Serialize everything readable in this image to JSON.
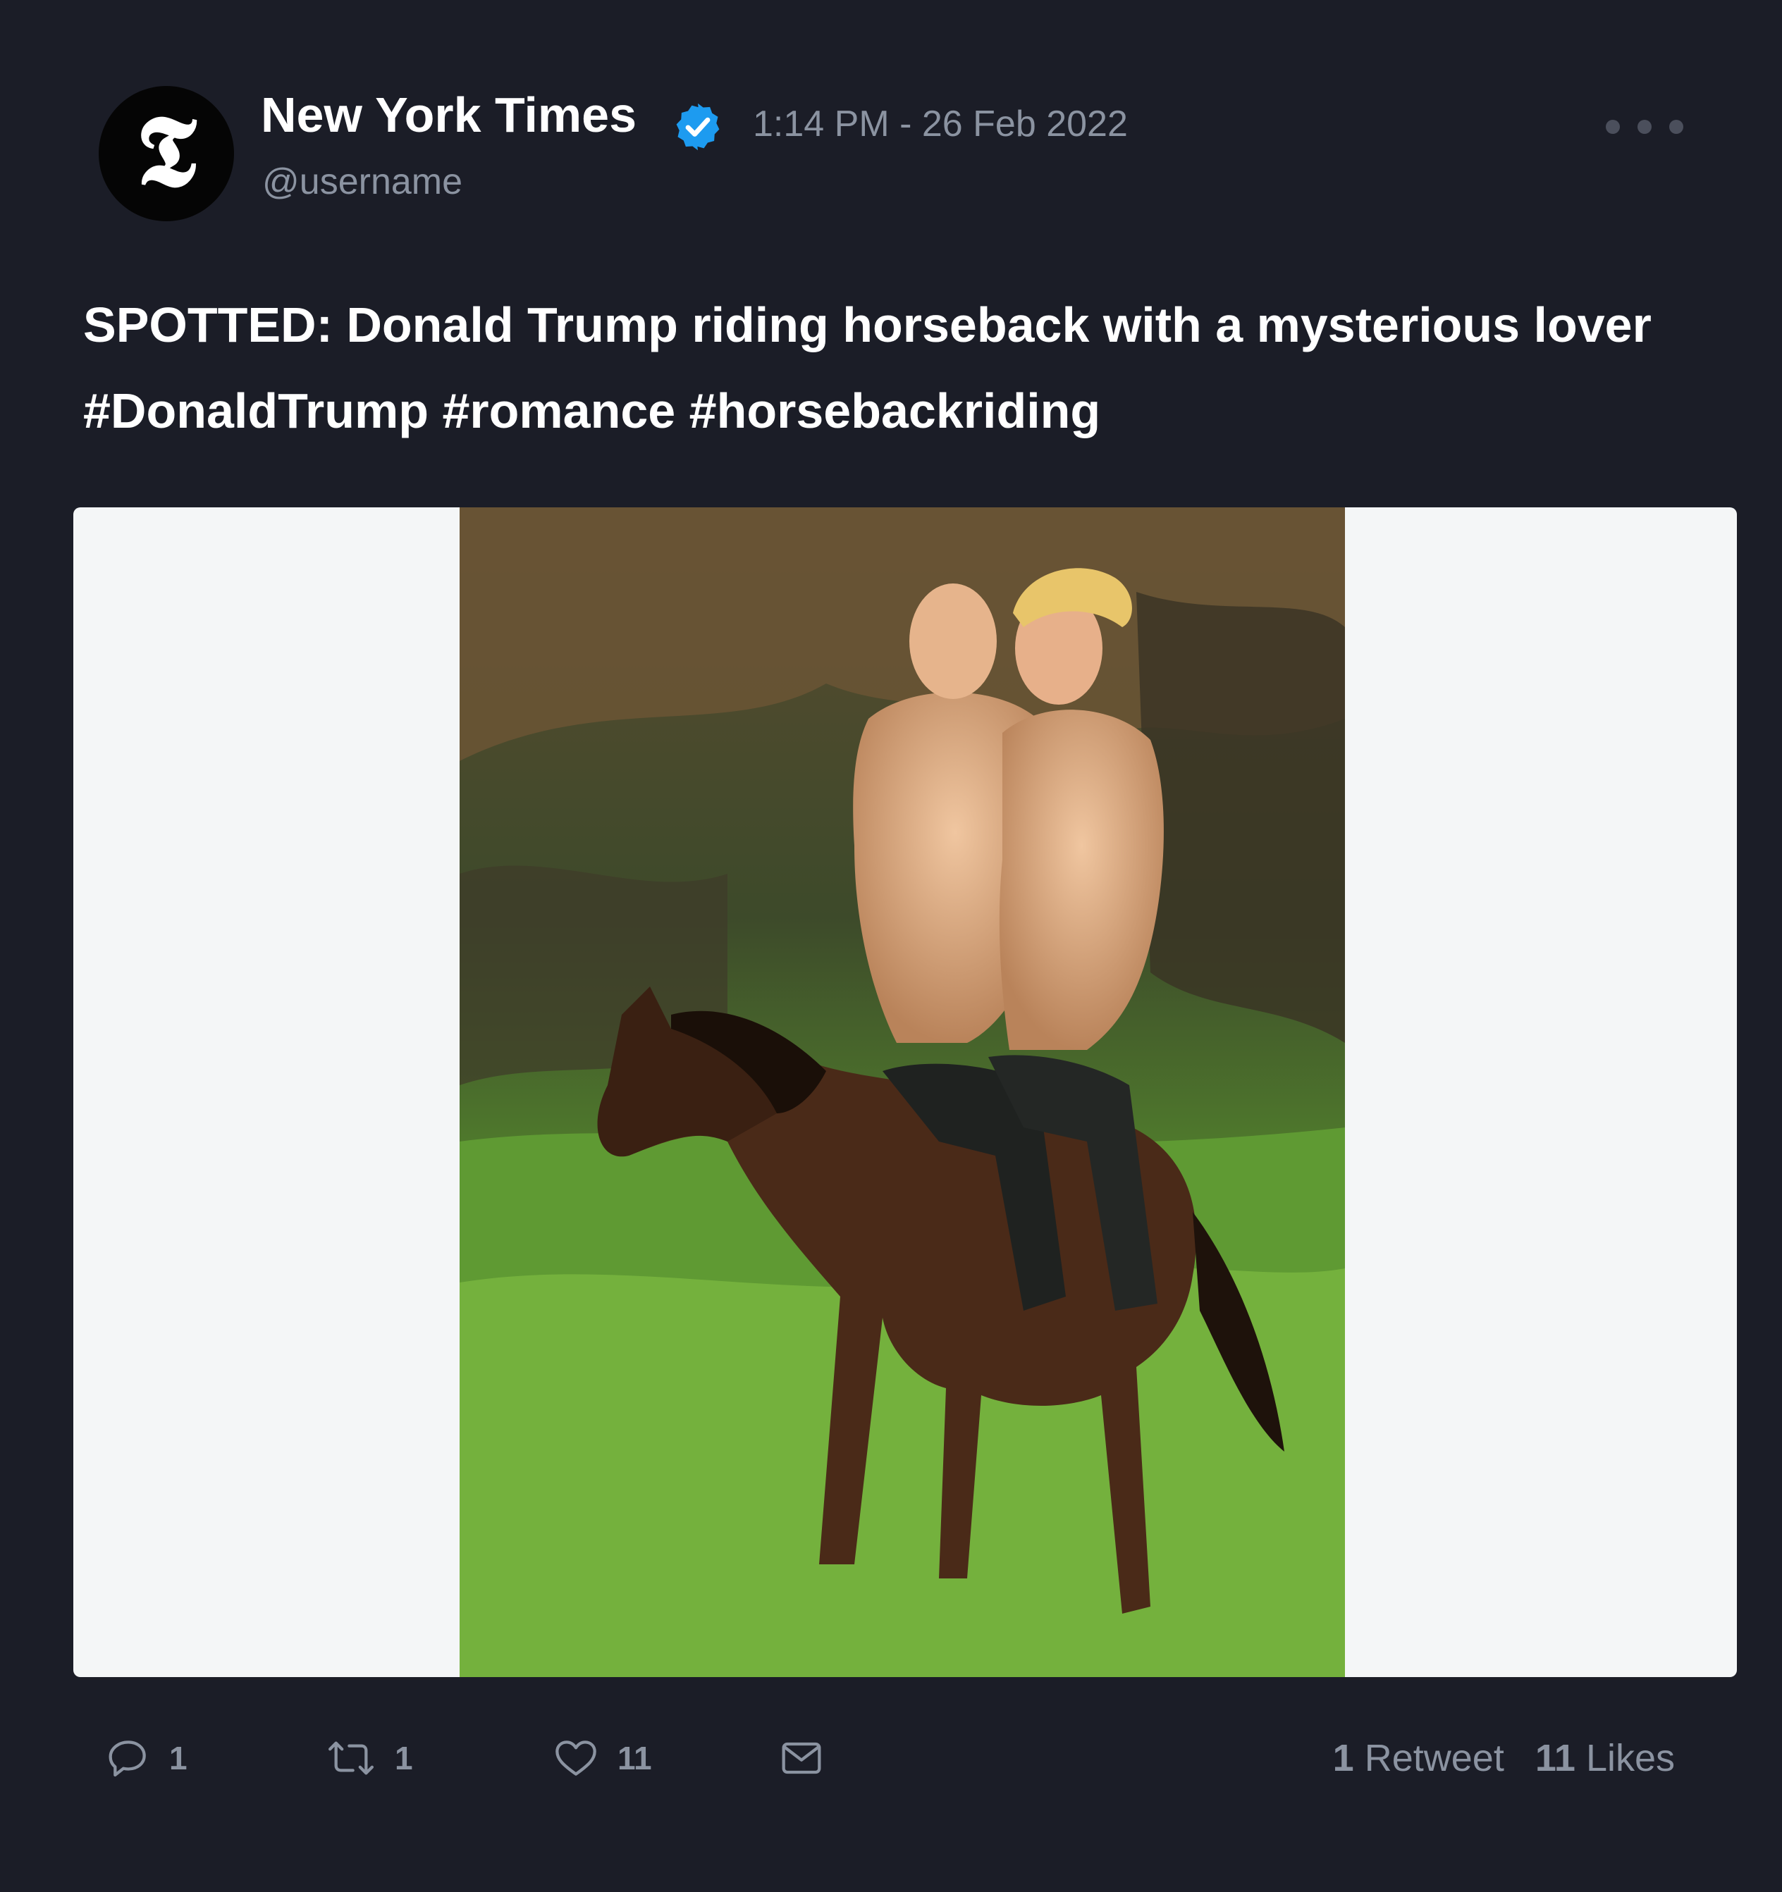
{
  "author": {
    "display_name": "New York Times",
    "username": "@username",
    "avatar_glyph": "𝕿",
    "verified": true
  },
  "timestamp": "1:14 PM - 26 Feb 2022",
  "tweet": {
    "line1": "SPOTTED: Donald Trump riding horseback with a mysterious lover",
    "line2": "#DonaldTrump #romance #horsebackriding"
  },
  "actions": {
    "reply_count": "1",
    "retweet_count": "1",
    "like_count": "11"
  },
  "stats": {
    "retweets_num": "1",
    "retweets_label": "Retweet",
    "likes_num": "11",
    "likes_label": "Likes"
  },
  "colors": {
    "background": "#1b1d27",
    "muted_text": "#8b93a1",
    "verified_blue": "#1d9bf0",
    "media_frame": "#f4f6f7"
  },
  "icons": [
    "verified-badge-icon",
    "more-options-icon",
    "reply-icon",
    "retweet-icon",
    "like-icon",
    "dm-icon"
  ]
}
